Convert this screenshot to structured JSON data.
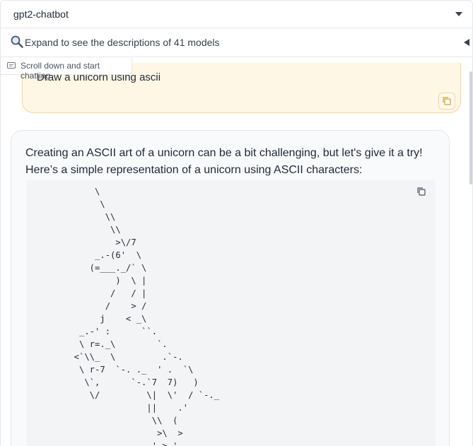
{
  "model_select": {
    "value": "gpt2-chatbot"
  },
  "accordion": {
    "label": "Expand to see the descriptions of 41 models"
  },
  "chat": {
    "label": "Scroll down and start chatting",
    "user_message": "Draw a unicorn using ascii",
    "bot_intro": "Creating an ASCII art of a unicorn can be a bit challenging, but let's give it a try! Here’s a simple representation of a unicorn using ASCII characters:",
    "ascii_art": "      \\\n       \\\n        \\\\\n         \\\\\n          >\\/7\n      _.-(6'  \\\n     (=___._/` \\\n          )  \\ |\n         /   / |\n        /    > /\n       j    < _\\\n   _.-' :      ``.\n   \\ r=._\\        `.\n  <`\\\\_  \\         .`-.\n   \\ r-7  `-. ._  ' .  `\\\n    \\`,      `-.`7  7)   )\n     \\/         \\|  \\'  / `-._\n                ||    .'\n                 \\\\  (\n                  >\\  >\n              ,.-' >.'"
  },
  "colors": {
    "user_bubble_bg": "#fff7e6",
    "user_bubble_border": "#fbd38d",
    "bot_bubble_bg": "#f9fafb",
    "code_bg": "#f3f4f6"
  },
  "icons": {
    "dropdown": "chevron-down-icon",
    "accordion_toggle": "triangle-left-icon",
    "magnifier": "magnifying-glass-icon",
    "chat": "chat-bubble-icon",
    "copy": "copy-icon"
  }
}
